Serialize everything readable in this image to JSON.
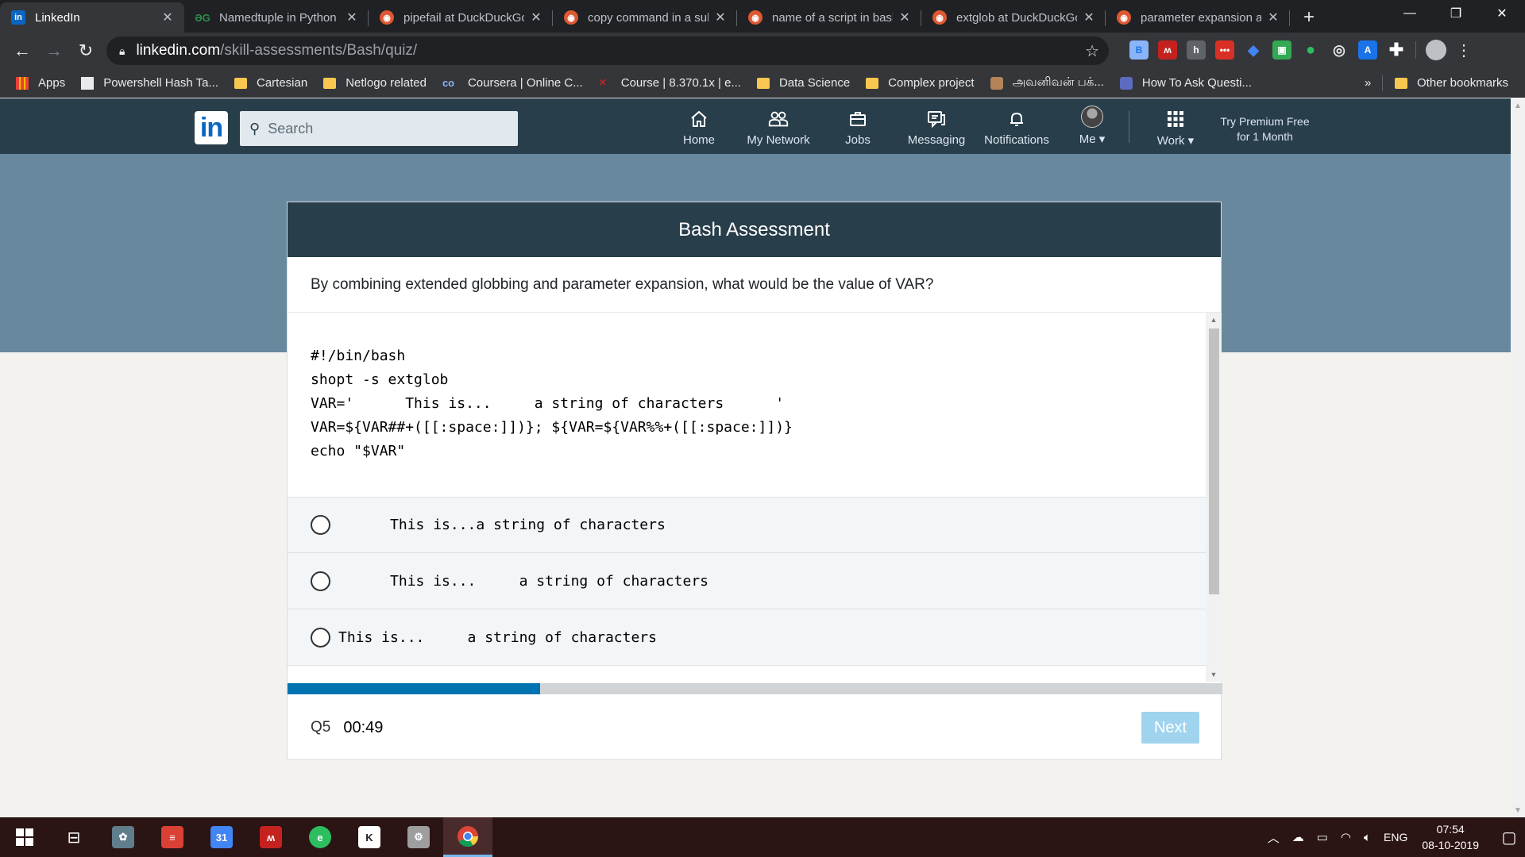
{
  "browser": {
    "tabs": [
      {
        "title": "LinkedIn",
        "favicon": "linkedin-icon",
        "active": true
      },
      {
        "title": "Namedtuple in Python",
        "favicon": "geeksforgeeks-icon",
        "active": false
      },
      {
        "title": "pipefail at DuckDuckGo",
        "favicon": "duckduckgo-icon",
        "active": false
      },
      {
        "title": "copy command in a sub",
        "favicon": "duckduckgo-icon",
        "active": false
      },
      {
        "title": "name of a script in bash",
        "favicon": "duckduckgo-icon",
        "active": false
      },
      {
        "title": "extglob at DuckDuckGo",
        "favicon": "duckduckgo-icon",
        "active": false
      },
      {
        "title": "parameter expansion a",
        "favicon": "duckduckgo-icon",
        "active": false
      }
    ],
    "new_tab_label": "+",
    "url_host": "linkedin.com",
    "url_path": "/skill-assessments/Bash/quiz/",
    "bookmarks": [
      {
        "label": "Apps",
        "icon": "apps-grid-icon"
      },
      {
        "label": "Powershell Hash Ta...",
        "icon": "page-icon"
      },
      {
        "label": "Cartesian",
        "icon": "folder-icon"
      },
      {
        "label": "Netlogo related",
        "icon": "folder-icon"
      },
      {
        "label": "Coursera | Online C...",
        "icon": "coursera-icon"
      },
      {
        "label": "Course | 8.370.1x | e...",
        "icon": "edx-icon"
      },
      {
        "label": "Data Science",
        "icon": "folder-icon"
      },
      {
        "label": "Complex project",
        "icon": "folder-icon"
      },
      {
        "label": "அவனிவன் பக்...",
        "icon": "avatar-icon"
      },
      {
        "label": "How To Ask Questi...",
        "icon": "wizard-icon"
      }
    ],
    "bookmarks_overflow": "»",
    "other_bookmarks": "Other bookmarks"
  },
  "linkedin": {
    "logo": "in",
    "search_placeholder": "Search",
    "nav": [
      {
        "label": "Home",
        "icon": "home-icon"
      },
      {
        "label": "My Network",
        "icon": "network-icon"
      },
      {
        "label": "Jobs",
        "icon": "briefcase-icon"
      },
      {
        "label": "Messaging",
        "icon": "messaging-icon"
      },
      {
        "label": "Notifications",
        "icon": "bell-icon"
      },
      {
        "label": "Me ▾",
        "icon": "avatar-icon"
      },
      {
        "label": "Work ▾",
        "icon": "grid-icon"
      }
    ],
    "premium_line1": "Try Premium Free",
    "premium_line2": "for 1 Month"
  },
  "assessment": {
    "title": "Bash Assessment",
    "question": "By combining extended globbing and parameter expansion, what would be the value of VAR?",
    "code": "#!/bin/bash\nshopt -s extglob\nVAR='      This is...     a string of characters      '\nVAR=${VAR##+([[:space:]])}; ${VAR=${VAR%%+([[:space:]])}\necho \"$VAR\"",
    "options": [
      "      This is...a string of characters",
      "      This is...     a string of characters",
      "This is...     a string of characters"
    ],
    "question_number": "Q5",
    "timer": "00:49",
    "next_label": "Next",
    "progress": 0.27
  },
  "taskbar": {
    "language": "ENG",
    "time": "07:54",
    "date": "08-10-2019",
    "calendar_day": "31"
  },
  "colors": {
    "linkedin_header": "#283e4a",
    "band": "#68889d",
    "progress_fill": "#0073b1",
    "next_disabled": "#a0d4ee"
  }
}
